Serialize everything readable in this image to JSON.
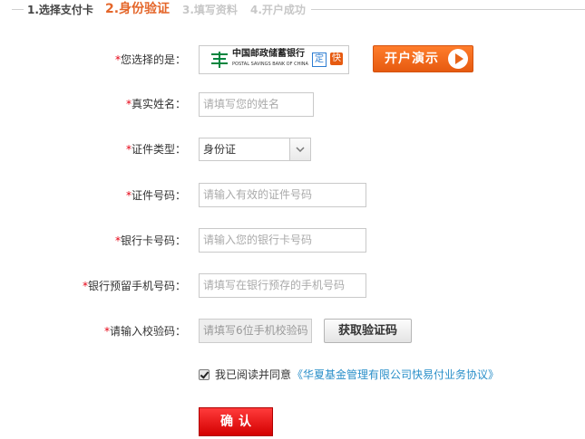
{
  "steps": [
    {
      "label": "1.选择支付卡"
    },
    {
      "label": "2.身份验证"
    },
    {
      "label": "3.填写资料"
    },
    {
      "label": "4.开户成功"
    }
  ],
  "bank": {
    "label": "您选择的是：",
    "name_cn": "中国邮政储蓄银行",
    "name_en": "POSTAL SAVINGS BANK OF CHINA",
    "tag_ding": "定",
    "tag_kuai": "快",
    "logo_color": "#00853e",
    "demo_button": "开户演示"
  },
  "form": {
    "required_mark": "*",
    "name": {
      "label": "真实姓名：",
      "placeholder": "请填写您的姓名"
    },
    "id_type": {
      "label": "证件类型：",
      "value": "身份证"
    },
    "id_number": {
      "label": "证件号码：",
      "placeholder": "请输入有效的证件号码"
    },
    "card_number": {
      "label": "银行卡号码：",
      "placeholder": "请输入您的银行卡号码"
    },
    "phone": {
      "label": "银行预留手机号码：",
      "placeholder": "请填写在银行预存的手机号码"
    },
    "verify": {
      "label": "请输入校验码：",
      "placeholder": "请填写6位手机校验码",
      "button": "获取验证码"
    }
  },
  "agreement": {
    "checked": true,
    "text": "我已阅读并同意",
    "link": "《华夏基金管理有限公司快易付业务协议》"
  },
  "confirm": {
    "label": "确认"
  },
  "colors": {
    "accent_orange": "#e4662a",
    "required_red": "#e60012",
    "confirm_red": "#e60000",
    "link_blue": "#2a8fc9"
  }
}
